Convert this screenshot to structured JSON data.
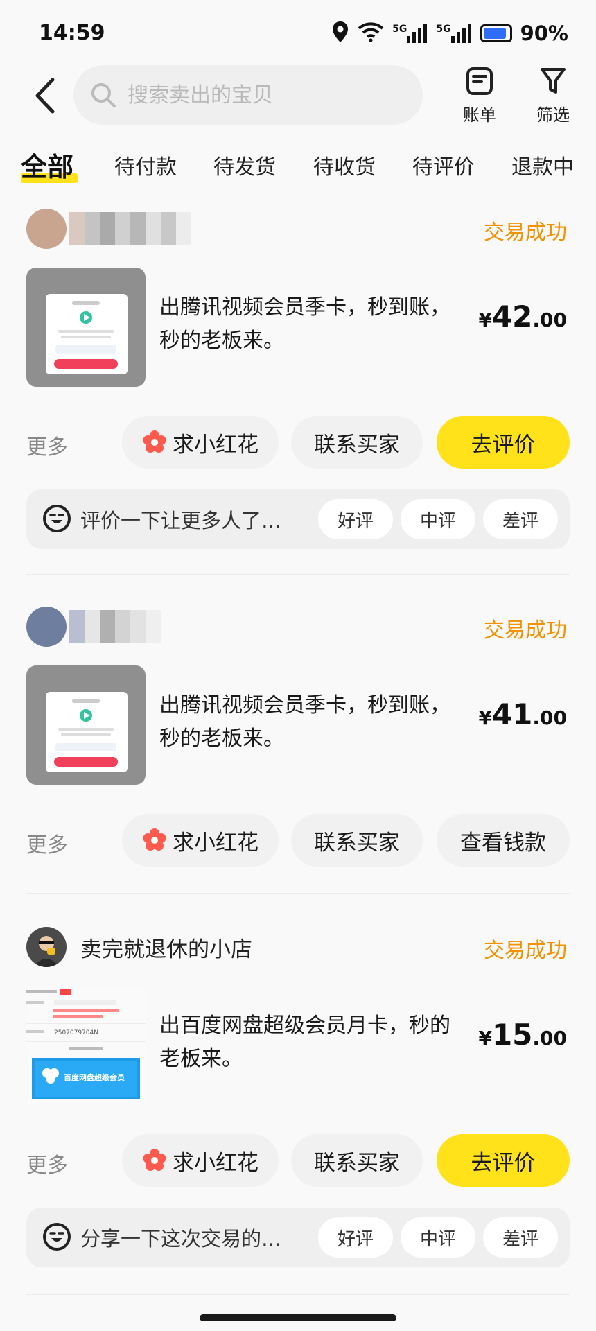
{
  "status_bar": {
    "time": "14:59",
    "network1": "5G",
    "network2": "5G",
    "battery": "90%",
    "battery_level": 0.9
  },
  "header": {
    "search_placeholder": "搜索卖出的宝贝",
    "bill_label": "账单",
    "filter_label": "筛选"
  },
  "tabs": [
    {
      "label": "全部",
      "active": true
    },
    {
      "label": "待付款"
    },
    {
      "label": "待发货"
    },
    {
      "label": "待收货"
    },
    {
      "label": "待评价"
    },
    {
      "label": "退款中"
    }
  ],
  "orders": [
    {
      "status": "交易成功",
      "title": "出腾讯视频会员季卡，秒到账，秒的老板来。",
      "price_currency": "¥",
      "price_int": "42",
      "price_dec": ".00",
      "more_label": "更多",
      "flower_label": "求小红花",
      "contact_label": "联系买家",
      "third_label": "去评价",
      "review_prompt": "评价一下让更多人了…",
      "review_good": "好评",
      "review_mid": "中评",
      "review_bad": "差评"
    },
    {
      "status": "交易成功",
      "title": "出腾讯视频会员季卡，秒到账，秒的老板来。",
      "price_currency": "¥",
      "price_int": "41",
      "price_dec": ".00",
      "more_label": "更多",
      "flower_label": "求小红花",
      "contact_label": "联系买家",
      "third_label": "查看钱款"
    },
    {
      "seller_name": "卖完就退休的小店",
      "status": "交易成功",
      "title": "出百度网盘超级会员月卡，秒的老板来。",
      "price_currency": "¥",
      "price_int": "15",
      "price_dec": ".00",
      "more_label": "更多",
      "flower_label": "求小红花",
      "contact_label": "联系买家",
      "third_label": "去评价",
      "review_prompt": "分享一下这次交易的…",
      "review_good": "好评",
      "review_mid": "中评",
      "review_bad": "差评",
      "thumb_order_no": "2507079704N",
      "thumb_banner": "百度网盘超级会员"
    }
  ],
  "colors": {
    "accent_yellow": "#ffe21a",
    "status_orange": "#f39200",
    "flower_red": "#ff5a4e"
  },
  "icons": [
    "back-arrow-icon",
    "search-icon",
    "bill-icon",
    "filter-icon",
    "flower-icon",
    "face-icon",
    "location-icon",
    "wifi-icon",
    "signal-icon",
    "battery-icon"
  ]
}
